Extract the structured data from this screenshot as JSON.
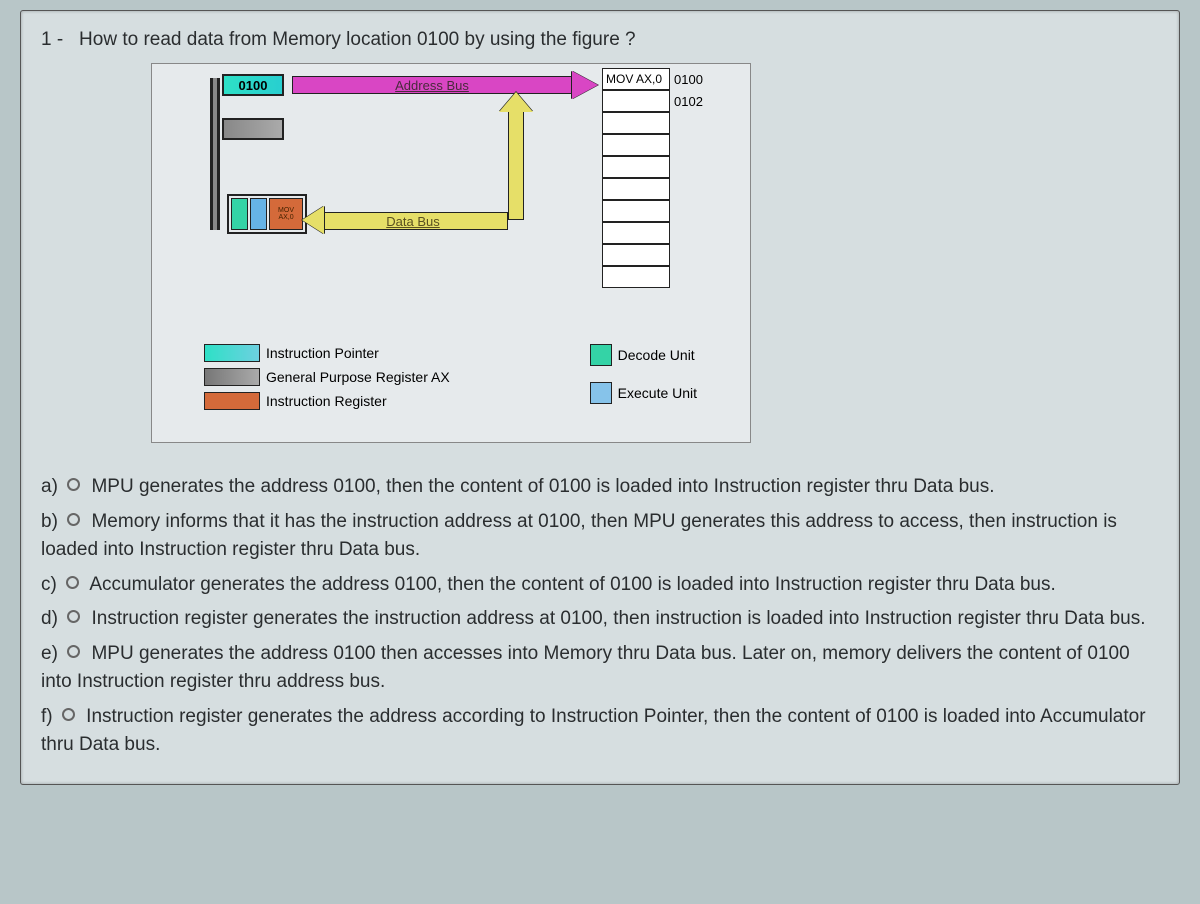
{
  "question": {
    "number": "1 -",
    "text": "How to read  data from Memory location  0100  by using the figure  ?"
  },
  "diagram": {
    "ip_value": "0100",
    "address_bus_label": "Address Bus",
    "data_bus_label": "Data Bus",
    "ir_top": "MOV",
    "ir_bot": "AX,0",
    "memory_rows": [
      {
        "content": "MOV AX,0",
        "addr": "0100"
      },
      {
        "content": "",
        "addr": "0102"
      },
      {
        "content": "",
        "addr": ""
      },
      {
        "content": "",
        "addr": ""
      },
      {
        "content": "",
        "addr": ""
      },
      {
        "content": "",
        "addr": ""
      },
      {
        "content": "",
        "addr": ""
      },
      {
        "content": "",
        "addr": ""
      },
      {
        "content": "",
        "addr": ""
      },
      {
        "content": "",
        "addr": ""
      }
    ],
    "legend": {
      "ip": "Instruction Pointer",
      "ax": "General Purpose Register AX",
      "ir": "Instruction Register",
      "decode": "Decode Unit",
      "execute": "Execute Unit"
    }
  },
  "options": {
    "a": {
      "label": "a)",
      "text": "MPU generates the address 0100, then the content of 0100 is loaded into Instruction register thru Data bus."
    },
    "b": {
      "label": "b)",
      "text": "Memory informs that it has the  instruction  address at 0100, then MPU generates this address to access, then instruction is loaded into Instruction register thru Data bus."
    },
    "c": {
      "label": "c)",
      "text": "Accumulator generates the address 0100, then the content of 0100 is loaded into Instruction register thru Data bus."
    },
    "d": {
      "label": "d)",
      "text": "Instruction register  generates the instruction  address at 0100, then instruction is loaded into Instruction register thru Data bus."
    },
    "e": {
      "label": "e)",
      "text": "MPU generates the address 0100 then accesses  into Memory thru Data bus. Later on, memory delivers the content of 0100 into Instruction register thru address bus."
    },
    "f": {
      "label": "f)",
      "text": "Instruction register generates the address according to Instruction Pointer, then the content of 0100 is loaded into Accumulator thru Data bus."
    }
  }
}
